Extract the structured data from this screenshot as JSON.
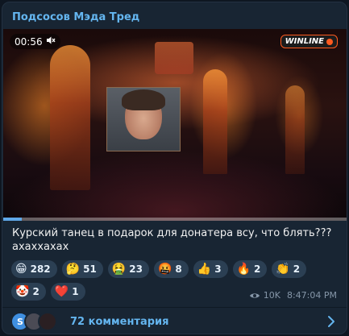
{
  "channel": {
    "name": "Подсосов Мэда Тред"
  },
  "video": {
    "duration": "00:56",
    "watermark": "WINLINE",
    "progress": 0.055,
    "mute_icon": "speaker-muted-icon"
  },
  "caption": "Курский танец в подарок для донатера всу, что блять??? ахаххахах",
  "reactions": [
    {
      "emoji": "😁",
      "count": "282"
    },
    {
      "emoji": "🤔",
      "count": "51"
    },
    {
      "emoji": "🤮",
      "count": "23"
    },
    {
      "emoji": "🤬",
      "count": "8"
    },
    {
      "emoji": "👍",
      "count": "3"
    },
    {
      "emoji": "🔥",
      "count": "2"
    },
    {
      "emoji": "👏",
      "count": "2"
    },
    {
      "emoji": "🤡",
      "count": "2"
    },
    {
      "emoji": "❤️",
      "count": "1"
    }
  ],
  "meta": {
    "views": "10K",
    "time": "8:47:04 PM"
  },
  "comments": {
    "label": "72 комментария",
    "avatars": [
      {
        "initial": "S",
        "color": "#3f8fe0"
      },
      {
        "initial": "",
        "color": "#4b4b55"
      },
      {
        "initial": "",
        "color": "#2a1f22"
      }
    ]
  },
  "colors": {
    "accent": "#64b5ef",
    "card": "#182533",
    "pill": "#2b3f53"
  }
}
